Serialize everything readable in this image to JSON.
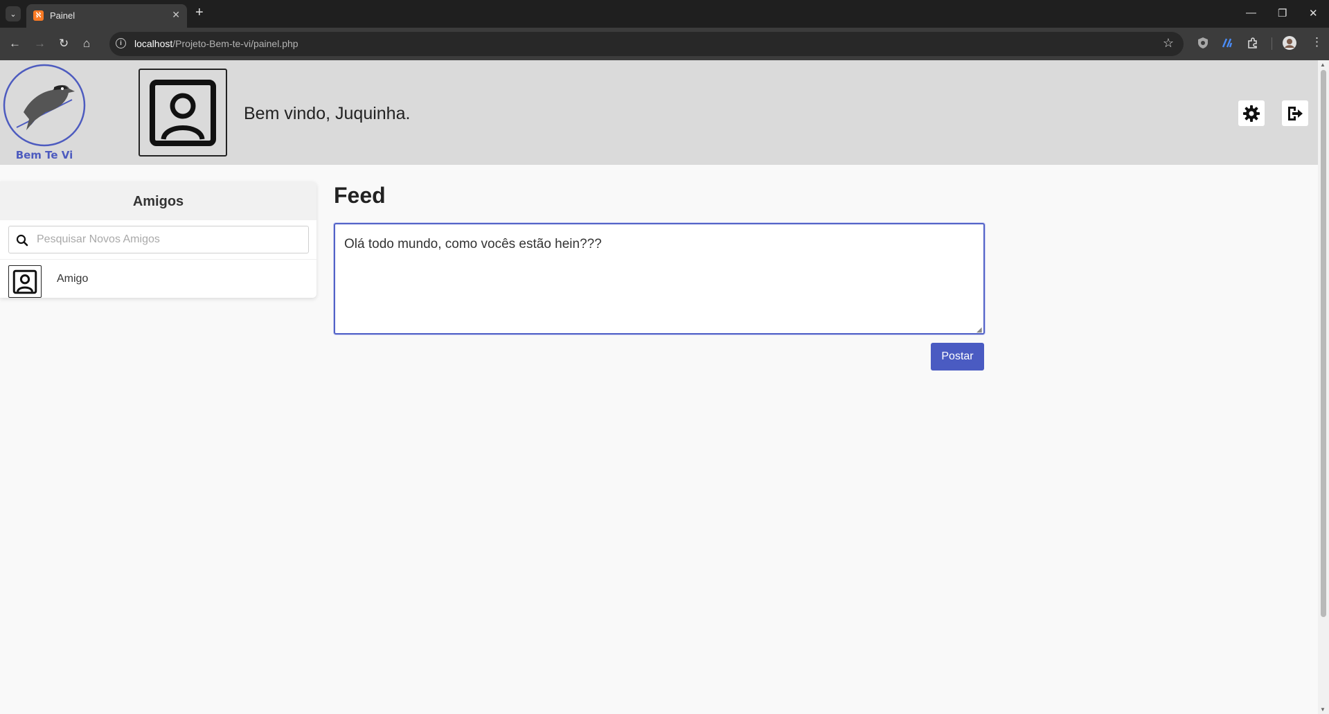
{
  "browser": {
    "tab_title": "Painel",
    "url_host": "localhost",
    "url_path": "/Projeto-Bem-te-vi/painel.php"
  },
  "header": {
    "logo_text": "Bem Te Vi",
    "welcome": "Bem vindo, Juquinha."
  },
  "friends": {
    "title": "Amigos",
    "search_placeholder": "Pesquisar Novos Amigos",
    "items": [
      {
        "name": "Amigo"
      }
    ]
  },
  "feed": {
    "title": "Feed",
    "post_text": "Olá todo mundo, como vocês estão hein???",
    "post_button": "Postar"
  },
  "colors": {
    "accent": "#4a5bc2",
    "header_bg": "#dadada"
  }
}
